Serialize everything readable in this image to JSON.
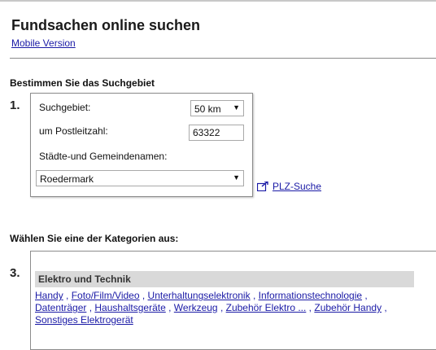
{
  "header": {
    "title": "Fundsachen online suchen",
    "mobile_link": "Mobile Version"
  },
  "search_area": {
    "heading": "Bestimmen Sie das Suchgebiet",
    "step_number": "1.",
    "radius_label": "Suchgebiet:",
    "radius_value": "50 km",
    "postcode_label": "um Postleitzahl:",
    "postcode_value": "63322",
    "city_label": "Städte-und Gemeindenamen:",
    "city_value": "Roedermark",
    "plz_link": "PLZ-Suche"
  },
  "categories": {
    "heading": "Wählen Sie eine der Kategorien aus:",
    "step_number": "3.",
    "group_title": "Elektro und Technik",
    "items": [
      "Handy",
      "Foto/Film/Video",
      "Unterhaltungselektronik",
      "Informationstechnologie",
      "Datenträger",
      "Haushaltsgeräte",
      "Werkzeug",
      "Zubehör Elektro ...",
      "Zubehör Handy",
      "Sonstiges Elektrogerät"
    ]
  }
}
